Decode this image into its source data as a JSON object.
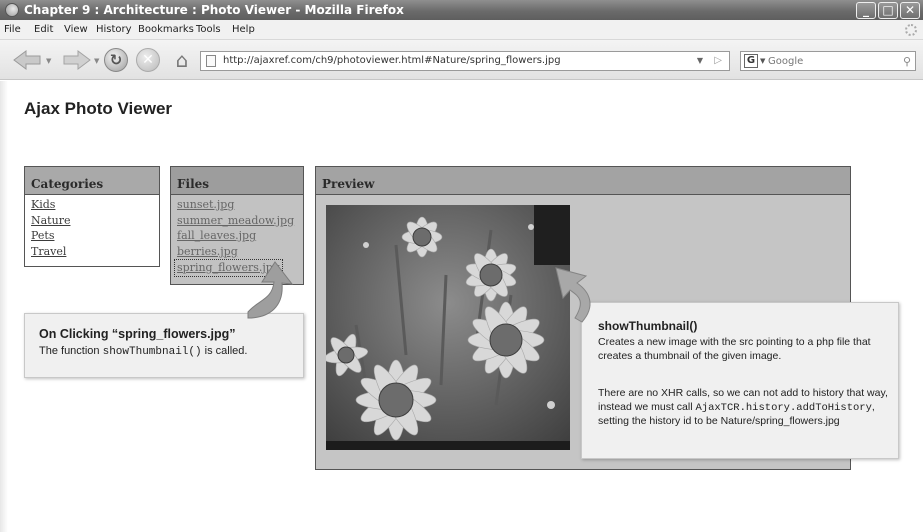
{
  "window": {
    "title": "Chapter 9 : Architecture : Photo Viewer - Mozilla Firefox"
  },
  "menu": {
    "items": [
      "File",
      "Edit",
      "View",
      "History",
      "Bookmarks",
      "Tools",
      "Help"
    ]
  },
  "nav": {
    "url": "http://ajaxref.com/ch9/photoviewer.html#Nature/spring_flowers.jpg",
    "search_placeholder": "Google",
    "search_engine_letter": "G"
  },
  "page": {
    "title": "Ajax Photo Viewer",
    "categories": {
      "header": "Categories",
      "items": [
        "Kids",
        "Nature",
        "Pets",
        "Travel"
      ]
    },
    "files": {
      "header": "Files",
      "items": [
        "sunset.jpg",
        "summer_meadow.jpg",
        "fall_leaves.jpg",
        "berries.jpg",
        "spring_flowers.jpg"
      ],
      "selected": "spring_flowers.jpg"
    },
    "preview": {
      "header": "Preview"
    }
  },
  "callouts": {
    "click": {
      "heading": "On Clicking “spring_flowers.jpg”",
      "text_before": "The function ",
      "code": "showThumbnail()",
      "text_after": " is called."
    },
    "thumb": {
      "heading": "showThumbnail()",
      "p1": "Creates a new image with the src pointing to a php file that creates a thumbnail of the given image.",
      "p2_before": "There are no XHR calls, so we can not add to history that way, instead we must call ",
      "p2_code": "AjaxTCR.history.addToHistory",
      "p2_after": ", setting the history id to be Nature/spring_flowers.jpg"
    }
  }
}
